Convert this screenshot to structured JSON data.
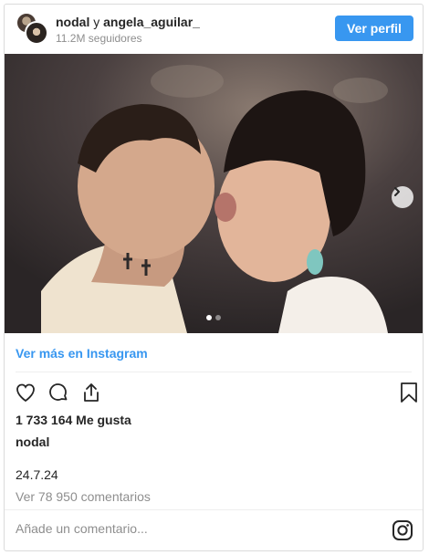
{
  "header": {
    "user1": "nodal",
    "conjunction": "y",
    "user2": "angela_aguilar_",
    "followers": "11.2M seguidores",
    "profile_button": "Ver perfil"
  },
  "carousel": {
    "total_images": 2,
    "current_index": 1
  },
  "view_more": "Ver más en Instagram",
  "likes": "1 733 164 Me gusta",
  "caption_user": "nodal",
  "date": "24.7.24",
  "comments": "Ver 78 950 comentarios",
  "comment_placeholder": "Añade un comentario...",
  "colors": {
    "accent": "#3897f0",
    "muted": "#8e8e8e",
    "border": "#dbdbdb"
  },
  "icons": [
    "heart-icon",
    "comment-icon",
    "share-icon",
    "bookmark-icon",
    "instagram-icon",
    "chevron-right-icon"
  ]
}
